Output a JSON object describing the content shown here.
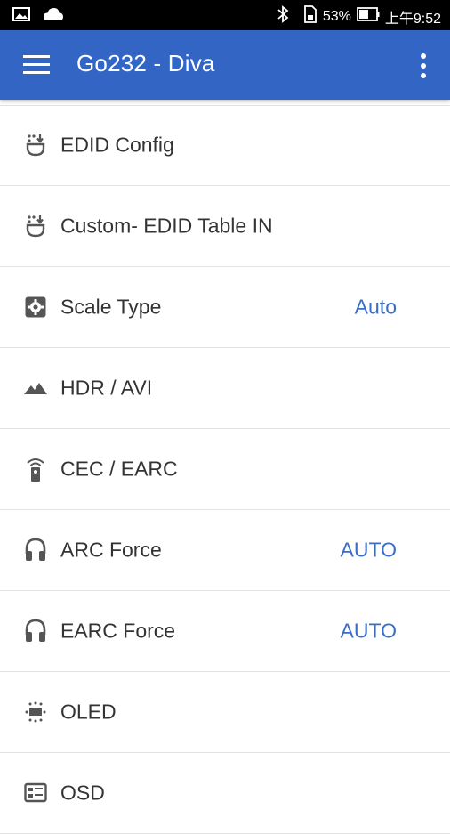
{
  "status_bar": {
    "left_icons": [
      "image-icon",
      "cloud-icon"
    ],
    "battery_percent": "53%",
    "time": "上午9:52"
  },
  "app_bar": {
    "title": "Go232 - Diva"
  },
  "items": [
    {
      "label": "EDID Config",
      "value": "",
      "icon": "edid-download-icon"
    },
    {
      "label": "Custom- EDID Table IN",
      "value": "",
      "icon": "edid-download-icon"
    },
    {
      "label": "Scale Type",
      "value": "Auto",
      "icon": "settings-box-icon"
    },
    {
      "label": "HDR / AVI",
      "value": "",
      "icon": "mountains-icon"
    },
    {
      "label": "CEC / EARC",
      "value": "",
      "icon": "remote-icon"
    },
    {
      "label": "ARC Force",
      "value": "AUTO",
      "icon": "headphones-icon"
    },
    {
      "label": "EARC Force",
      "value": "AUTO",
      "icon": "headphones-icon"
    },
    {
      "label": "OLED",
      "value": "",
      "icon": "display-dots-icon"
    },
    {
      "label": "OSD",
      "value": "",
      "icon": "osd-icon"
    }
  ],
  "colors": {
    "app_bar": "#3366c4",
    "value_text": "#3a6ec6",
    "label_text": "#333333"
  }
}
